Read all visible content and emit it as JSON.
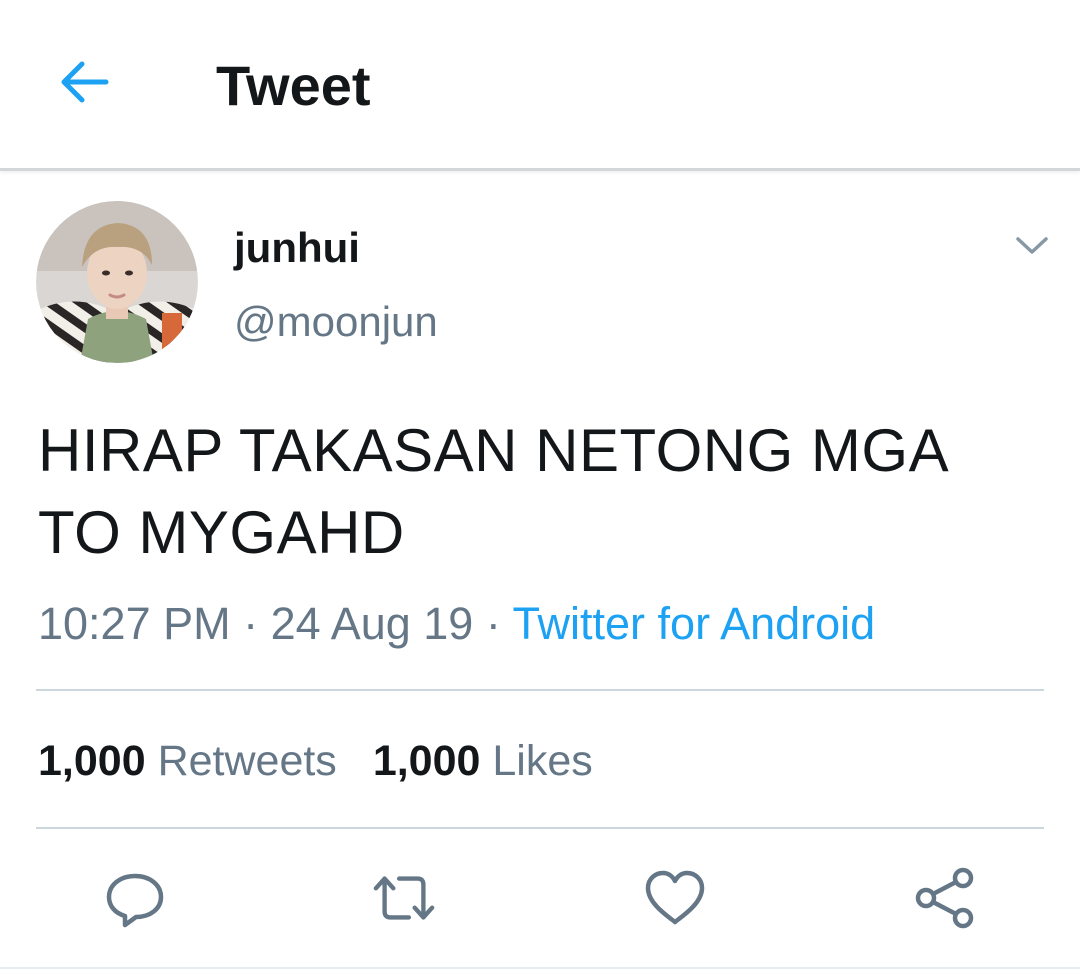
{
  "header": {
    "title": "Tweet",
    "back_icon": "arrow-left-icon"
  },
  "tweet": {
    "author": {
      "name": "junhui",
      "handle": "@moonjun",
      "avatar_icon": "avatar-photo"
    },
    "text_lines": [
      "HIRAP TAKASAN NETONG MGA",
      "TO MYGAHD"
    ],
    "time": "10:27 PM",
    "separator": " · ",
    "date": "24 Aug 19",
    "source": "Twitter for Android",
    "stats": {
      "retweets_count": "1,000",
      "retweets_label": "Retweets",
      "likes_count": "1,000",
      "likes_label": "Likes"
    },
    "actions": [
      "reply-icon",
      "retweet-icon",
      "like-icon",
      "share-icon"
    ]
  },
  "colors": {
    "accent": "#1da1f2",
    "text": "#14171a",
    "secondary": "#657786",
    "divider": "#ccd6dd"
  }
}
